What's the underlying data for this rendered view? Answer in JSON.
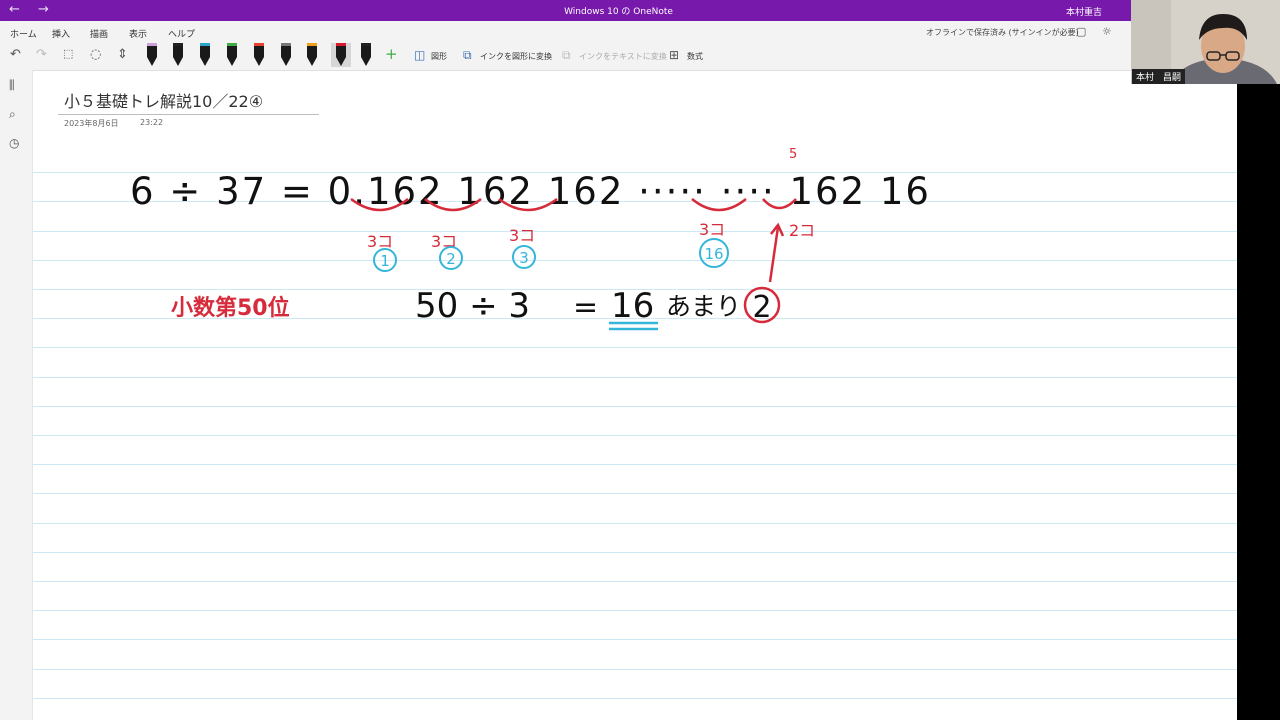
{
  "window": {
    "title": "Windows 10 の OneNote",
    "user": "本村重吉",
    "back_glyph": "←",
    "forward_glyph": "→"
  },
  "menu": {
    "tabs": [
      {
        "label": "ホーム"
      },
      {
        "label": "挿入"
      },
      {
        "label": "描画"
      },
      {
        "label": "表示"
      },
      {
        "label": "ヘルプ"
      }
    ],
    "active_tab": "描画",
    "sync_status": "オフラインで保存済み (サインインが必要)"
  },
  "toolbar": {
    "pens": [
      {
        "color": "#c9a0dc"
      },
      {
        "color": "#222222"
      },
      {
        "color": "#2aa5c9"
      },
      {
        "color": "#3fae49"
      },
      {
        "color": "#e8422e"
      },
      {
        "color": "#777777"
      },
      {
        "color": "#f0a020"
      },
      {
        "color": "#d81b2c"
      },
      {
        "color": "#222222"
      }
    ],
    "shapes_label": "図形",
    "ink_to_shape_label": "インクを図形に変換",
    "ink_to_text_label": "インクをテキストに変換",
    "math_label": "数式"
  },
  "page": {
    "title": "小５基礎トレ解説10／22④",
    "date": "2023年8月6日",
    "time": "23:22"
  },
  "ink": {
    "equation": "6 ÷ 37 = 0.162 162 162 ····· ···· 162 16",
    "digit_above": "5",
    "group_counts": [
      "3コ",
      "3コ",
      "3コ",
      "3コ"
    ],
    "group_numbers": [
      "1",
      "2",
      "3",
      "16"
    ],
    "arrow_note": "2コ",
    "decimal_place_label": "小数第50位",
    "division": "50 ÷ 3",
    "equals": "=",
    "quotient": "16",
    "remainder_word": "あまり",
    "remainder": "2",
    "colors": {
      "black": "#111111",
      "red": "#d62b3a",
      "blue": "#34b5da"
    }
  },
  "webcam": {
    "name": "本村　昌嗣"
  }
}
